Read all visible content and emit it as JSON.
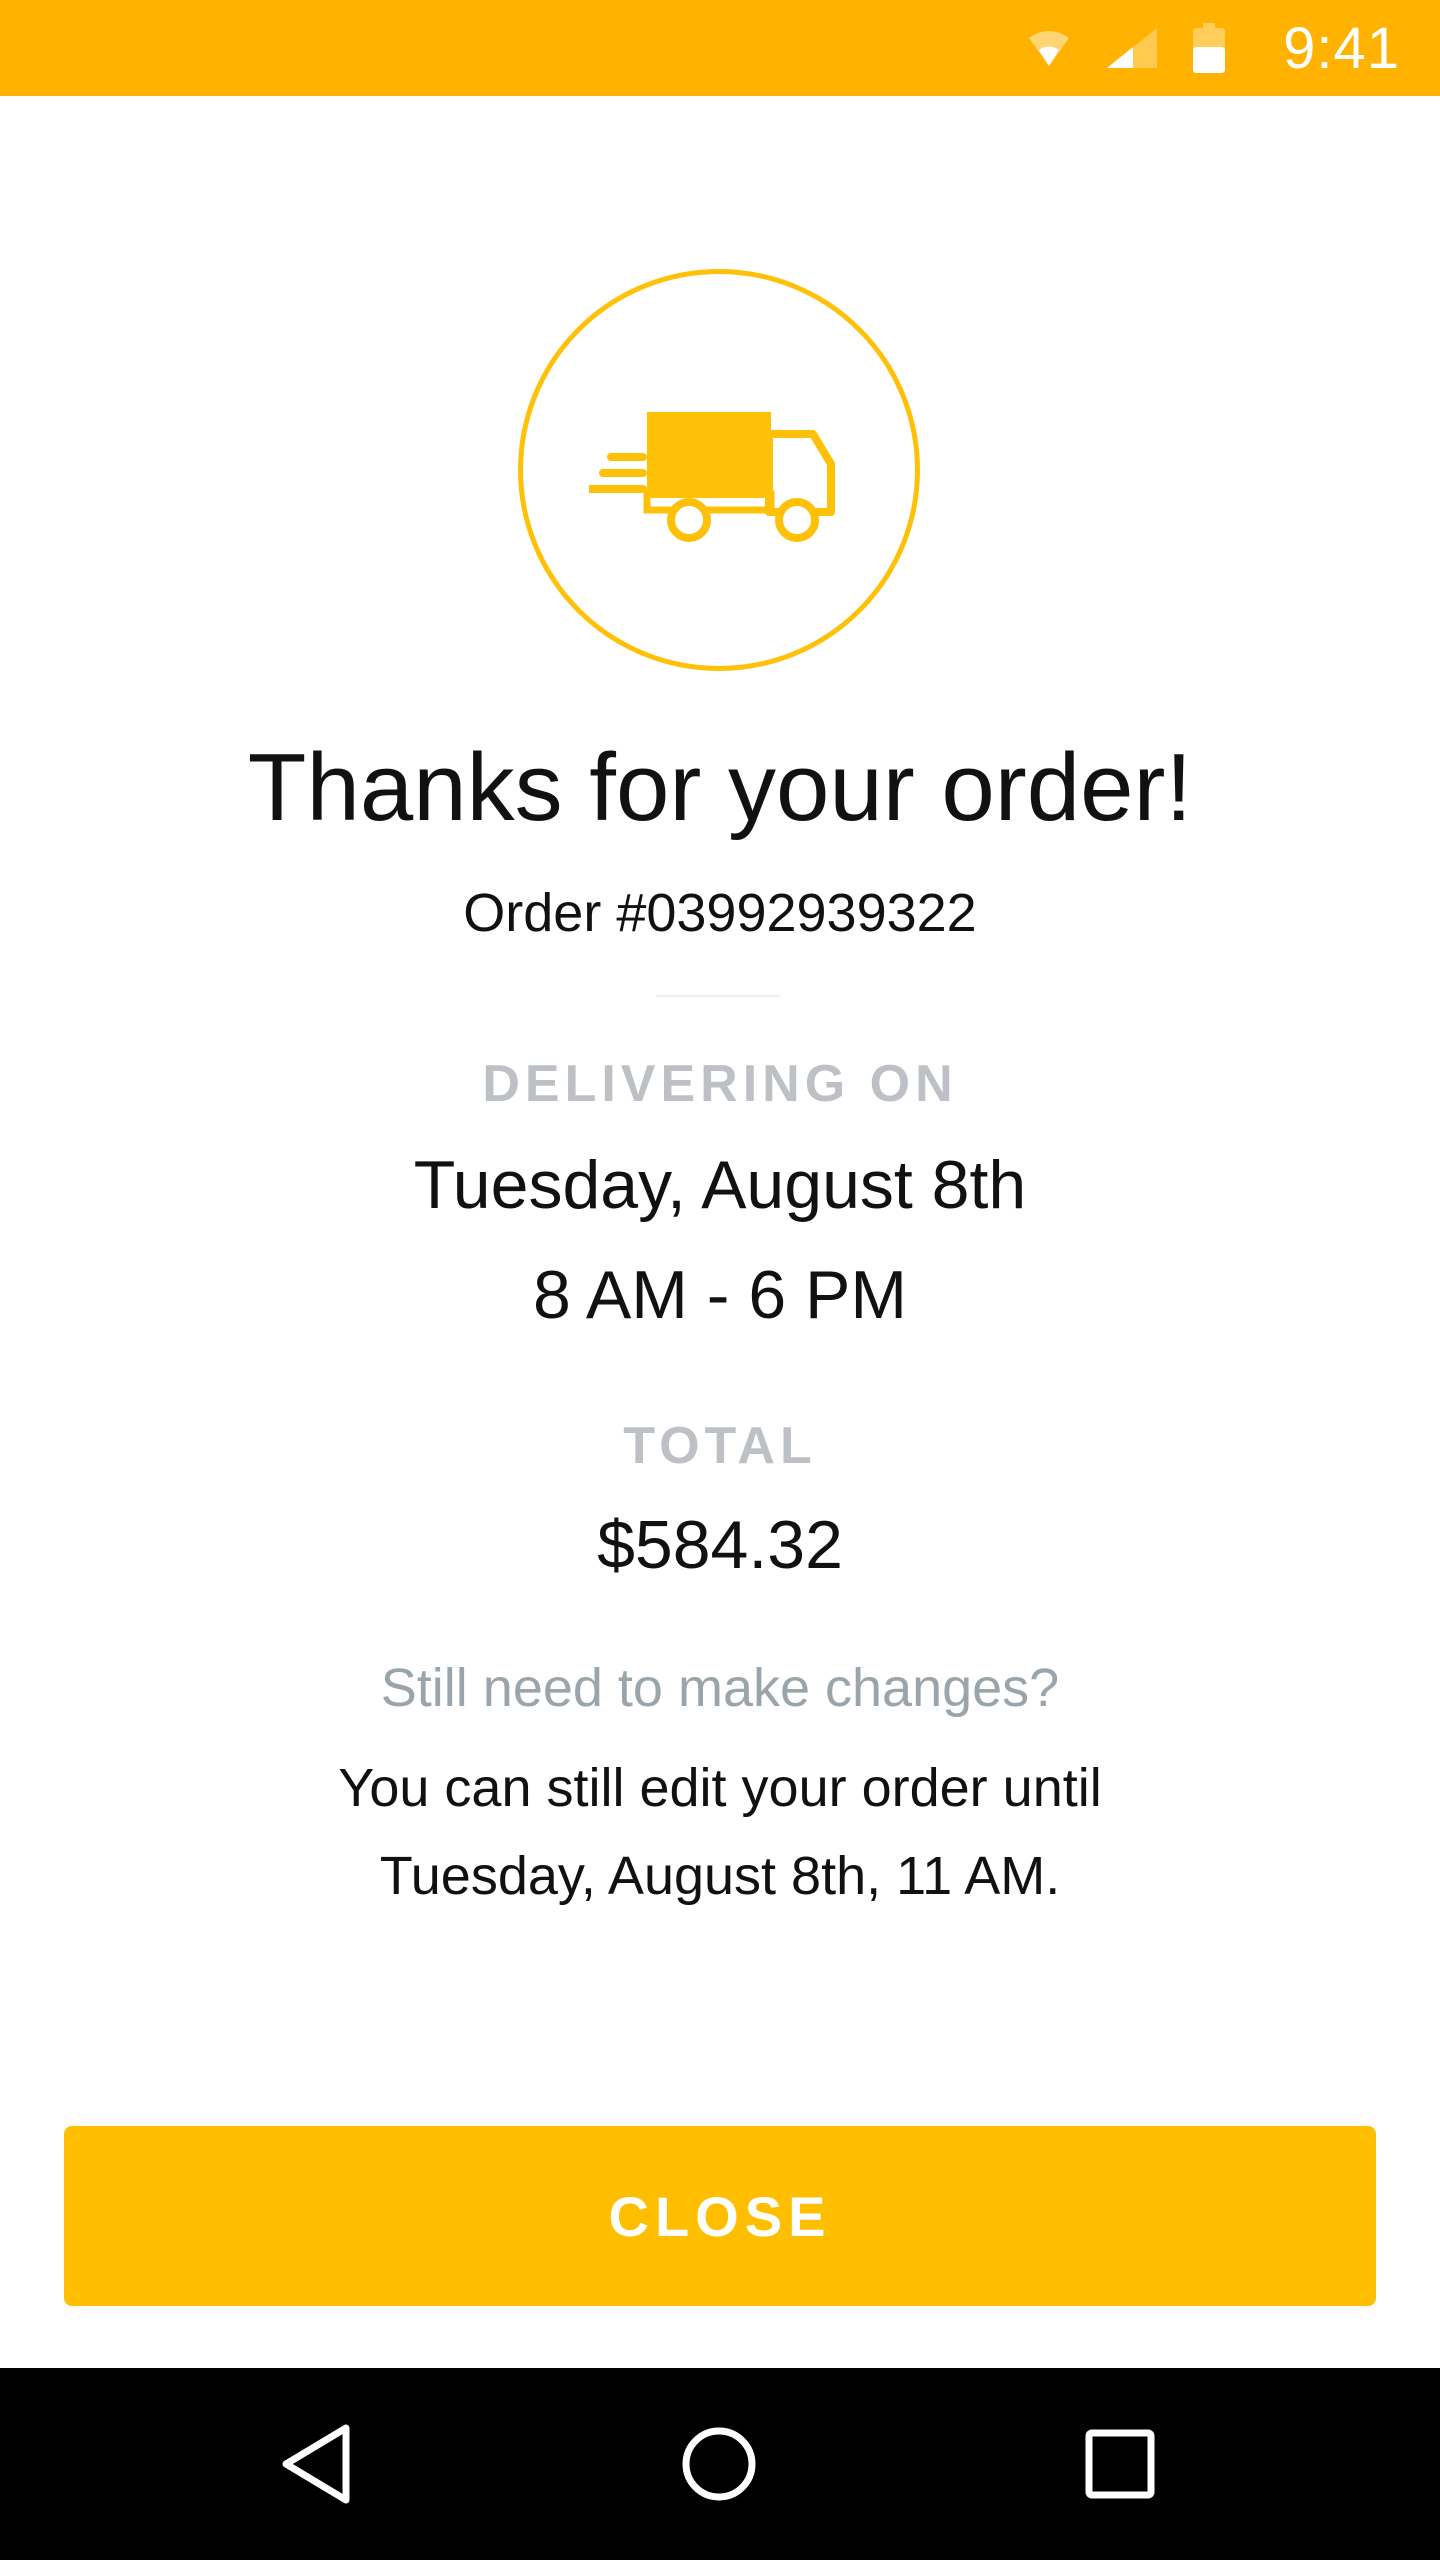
{
  "status_bar": {
    "time": "9:41",
    "background_color": "#FFB300",
    "icons": [
      "wifi-icon",
      "cell-signal-icon",
      "battery-icon"
    ]
  },
  "confirmation": {
    "icon": "delivery-truck-icon",
    "accent_color": "#FFC107",
    "heading": "Thanks for your order!",
    "order_number": "Order #03992939322"
  },
  "delivery": {
    "label": "DELIVERING ON",
    "date": "Tuesday, August 8th",
    "time_window": "8 AM - 6 PM"
  },
  "total": {
    "label": "TOTAL",
    "amount": "$584.32"
  },
  "changes": {
    "question": "Still need to make changes?",
    "line1": "You can still edit your order until",
    "line2": "Tuesday, August 8th, 11 AM."
  },
  "actions": {
    "close_label": "CLOSE"
  },
  "nav_bar": {
    "buttons": [
      "back-icon",
      "home-icon",
      "recent-apps-icon"
    ]
  }
}
